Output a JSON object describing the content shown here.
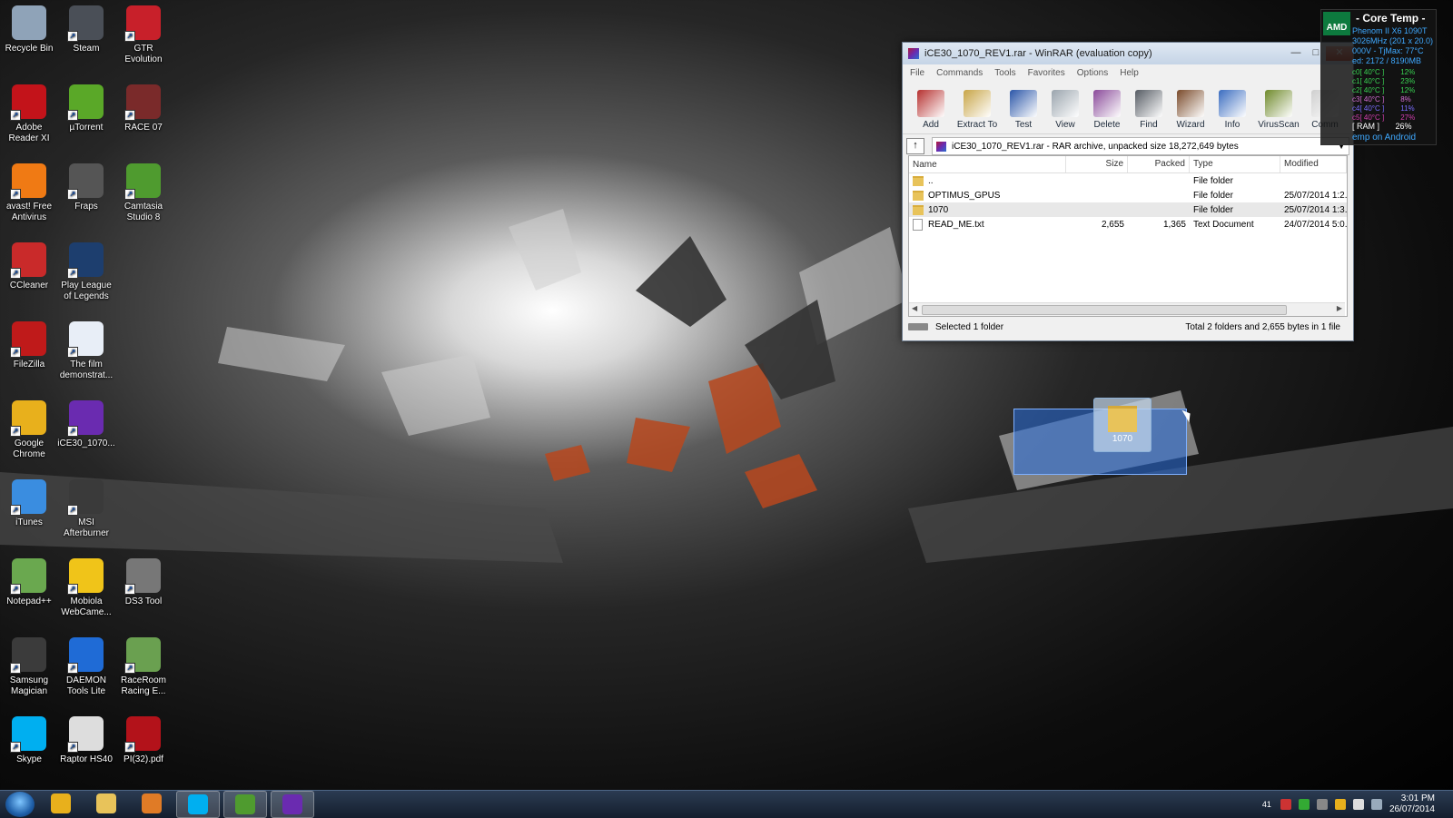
{
  "desktop": {
    "icons": [
      {
        "label": "Recycle Bin",
        "icon": "recycle-bin-icon",
        "color": "#8fa3b8"
      },
      {
        "label": "Steam",
        "icon": "steam-icon",
        "color": "#4a4f57"
      },
      {
        "label": "GTR Evolution",
        "icon": "gtr-evolution-icon",
        "color": "#c8202a"
      },
      {
        "label": "Adobe Reader XI",
        "icon": "adobe-reader-icon",
        "color": "#c3131a"
      },
      {
        "label": "µTorrent",
        "icon": "utorrent-icon",
        "color": "#5aa828"
      },
      {
        "label": "RACE 07",
        "icon": "race07-icon",
        "color": "#7a2a2a"
      },
      {
        "label": "avast! Free Antivirus",
        "icon": "avast-icon",
        "color": "#f07a14"
      },
      {
        "label": "Fraps",
        "icon": "fraps-icon",
        "color": "#555555"
      },
      {
        "label": "Camtasia Studio 8",
        "icon": "camtasia-icon",
        "color": "#4f9b2f"
      },
      {
        "label": "CCleaner",
        "icon": "ccleaner-icon",
        "color": "#c92a2a"
      },
      {
        "label": "Play League of Legends",
        "icon": "league-of-legends-icon",
        "color": "#1d3e6e"
      },
      {
        "label": "FileZilla",
        "icon": "filezilla-icon",
        "color": "#bf1a1a"
      },
      {
        "label": "The film demonstrat...",
        "icon": "word-document-icon",
        "color": "#e8eef7"
      },
      {
        "label": "Google Chrome",
        "icon": "chrome-icon",
        "color": "#e8b01c"
      },
      {
        "label": "iCE30_1070...",
        "icon": "winrar-archive-icon",
        "color": "#6a2bb0"
      },
      {
        "label": "iTunes",
        "icon": "itunes-icon",
        "color": "#3a8de0"
      },
      {
        "label": "MSI Afterburner",
        "icon": "msi-afterburner-icon",
        "color": "#3a3a3a"
      },
      {
        "label": "Notepad++",
        "icon": "notepad-plus-plus-icon",
        "color": "#6aa84f"
      },
      {
        "label": "Mobiola WebCame...",
        "icon": "mobiola-webcam-icon",
        "color": "#f0c419"
      },
      {
        "label": "DS3 Tool",
        "icon": "ds3-tool-icon",
        "color": "#777777"
      },
      {
        "label": "Samsung Magician",
        "icon": "samsung-magician-icon",
        "color": "#3b3b3b"
      },
      {
        "label": "DAEMON Tools Lite",
        "icon": "daemon-tools-icon",
        "color": "#1f6bd6"
      },
      {
        "label": "RaceRoom Racing E...",
        "icon": "raceroom-icon",
        "color": "#6aa050"
      },
      {
        "label": "Skype",
        "icon": "skype-icon",
        "color": "#00aff0"
      },
      {
        "label": "Raptor HS40",
        "icon": "raptor-hs40-icon",
        "color": "#dddddd"
      },
      {
        "label": "PI(32).pdf",
        "icon": "pdf-file-icon",
        "color": "#b3121a"
      }
    ]
  },
  "winrar": {
    "title": "iCE30_1070_REV1.rar - WinRAR (evaluation copy)",
    "menu": [
      "File",
      "Commands",
      "Tools",
      "Favorites",
      "Options",
      "Help"
    ],
    "toolbar": [
      {
        "label": "Add",
        "icon": "add-icon",
        "color": "#b6302f"
      },
      {
        "label": "Extract To",
        "icon": "extract-icon",
        "color": "#c8a546"
      },
      {
        "label": "Test",
        "icon": "test-icon",
        "color": "#2a55a8"
      },
      {
        "label": "View",
        "icon": "view-icon",
        "color": "#9aa4ad"
      },
      {
        "label": "Delete",
        "icon": "delete-icon",
        "color": "#8a4a9a"
      },
      {
        "label": "Find",
        "icon": "find-icon",
        "color": "#555b63"
      },
      {
        "label": "Wizard",
        "icon": "wizard-icon",
        "color": "#7a4a2a"
      },
      {
        "label": "Info",
        "icon": "info-icon",
        "color": "#3a6cc0"
      },
      {
        "label": "VirusScan",
        "icon": "virusscan-icon",
        "color": "#6f8a2b"
      },
      {
        "label": "Comm",
        "icon": "comment-icon",
        "color": "#cfcfcf"
      }
    ],
    "path": "iCE30_1070_REV1.rar - RAR archive, unpacked size 18,272,649 bytes",
    "columns": {
      "name": "Name",
      "size": "Size",
      "packed": "Packed",
      "type": "Type",
      "modified": "Modified"
    },
    "files": [
      {
        "name": "..",
        "size": "",
        "packed": "",
        "type": "File folder",
        "modified": "",
        "kind": "folder"
      },
      {
        "name": "OPTIMUS_GPUS",
        "size": "",
        "packed": "",
        "type": "File folder",
        "modified": "25/07/2014 1:2...",
        "kind": "folder"
      },
      {
        "name": "1070",
        "size": "",
        "packed": "",
        "type": "File folder",
        "modified": "25/07/2014 1:3...",
        "kind": "folder"
      },
      {
        "name": "READ_ME.txt",
        "size": "2,655",
        "packed": "1,365",
        "type": "Text Document",
        "modified": "24/07/2014 5:0...",
        "kind": "file"
      }
    ],
    "status_left": "Selected 1 folder",
    "status_right": "Total 2 folders and 2,655 bytes in 1 file"
  },
  "coretemp": {
    "brand": "AMD",
    "title": "- Core Temp -",
    "cpu": "Phenom II X6 1090T",
    "lines": [
      "3026MHz (201 x 20.0)",
      "000V - TjMax: 77°C",
      "ed: 2172 / 8190MB"
    ],
    "cores": [
      {
        "label": "c0[ 40°C ]",
        "load": "12%",
        "color": "#39d353"
      },
      {
        "label": "c1[ 40°C ]",
        "load": "23%",
        "color": "#39d353"
      },
      {
        "label": "c2[ 40°C ]",
        "load": "12%",
        "color": "#39d353"
      },
      {
        "label": "c3[ 40°C ]",
        "load": "8%",
        "color": "#d36dd3"
      },
      {
        "label": "c4[ 40°C ]",
        "load": "11%",
        "color": "#7a6dff"
      },
      {
        "label": "c5[ 40°C ]",
        "load": "27%",
        "color": "#d33fb0"
      }
    ],
    "ram": "[ RAM ]",
    "ram_load": "26%",
    "footer": "emp on Android"
  },
  "drag": {
    "label": "1070"
  },
  "taskbar": {
    "apps": [
      {
        "icon": "chrome-icon",
        "color": "#e8b01c",
        "active": false
      },
      {
        "icon": "explorer-icon",
        "color": "#e8c35a",
        "active": false
      },
      {
        "icon": "media-player-icon",
        "color": "#e07b26",
        "active": false
      },
      {
        "icon": "skype-icon",
        "color": "#00aff0",
        "active": true
      },
      {
        "icon": "camtasia-icon",
        "color": "#4f9b2f",
        "active": true
      },
      {
        "icon": "winrar-icon",
        "color": "#6a2bb0",
        "active": true
      }
    ],
    "tray_count": "41",
    "time": "3:01 PM",
    "date": "26/07/2014"
  }
}
